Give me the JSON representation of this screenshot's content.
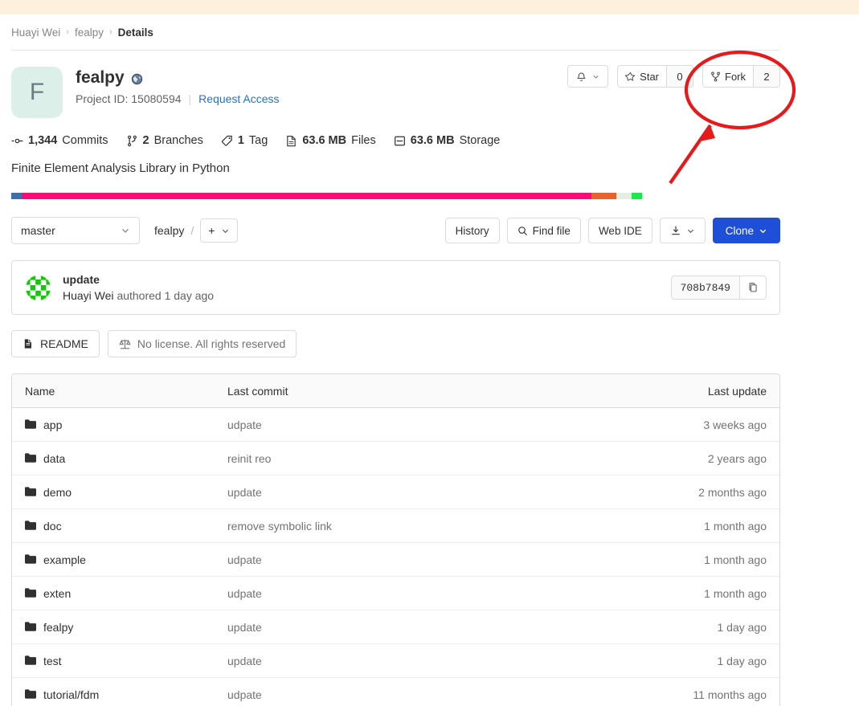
{
  "breadcrumb": {
    "items": [
      {
        "label": "Huayi Wei",
        "current": false
      },
      {
        "label": "fealpy",
        "current": false
      },
      {
        "label": "Details",
        "current": true
      }
    ],
    "separator": "›"
  },
  "project": {
    "avatar_letter": "F",
    "avatar_bg": "#dcefe9",
    "name": "fealpy",
    "visibility_icon": "globe-icon",
    "project_id_label": "Project ID: 15080594",
    "request_access_label": "Request Access",
    "description": "Finite Element Analysis Library in Python"
  },
  "actions": {
    "notification_icon": "bell-icon",
    "notification_caret": "chevron-down-icon",
    "star_icon": "star-icon",
    "star_label": "Star",
    "star_count": "0",
    "fork_icon": "fork-icon",
    "fork_label": "Fork",
    "fork_count": "2"
  },
  "stats": [
    {
      "icon": "commit-icon",
      "value": "1,344",
      "unit": "Commits"
    },
    {
      "icon": "branch-icon",
      "value": "2",
      "unit": "Branches"
    },
    {
      "icon": "tag-icon",
      "value": "1",
      "unit": "Tag"
    },
    {
      "icon": "file-icon",
      "value": "63.6 MB",
      "unit": "Files"
    },
    {
      "icon": "storage-icon",
      "value": "63.6 MB",
      "unit": "Storage"
    }
  ],
  "language_bar": [
    {
      "color": "#3f6fa8",
      "pct": 1.4
    },
    {
      "color": "#fc0a77",
      "pct": 74.0
    },
    {
      "color": "#e9622c",
      "pct": 3.3
    },
    {
      "color": "#e2efe2",
      "pct": 2.0
    },
    {
      "color": "#1ce84b",
      "pct": 1.3
    }
  ],
  "toolbar": {
    "branch": "master",
    "branch_caret": "chevron-down-icon",
    "path_root": "fealpy",
    "path_slash": "/",
    "plus_label": "+",
    "plus_caret": "chevron-down-icon",
    "history_label": "History",
    "find_file_label": "Find file",
    "find_file_icon": "search-icon",
    "web_ide_label": "Web IDE",
    "download_icon": "download-icon",
    "download_caret": "chevron-down-icon",
    "clone_label": "Clone",
    "clone_caret": "chevron-down-icon",
    "clone_color": "#1f4fd8"
  },
  "commit": {
    "avatar_icon": "identicon-avatar",
    "message": "update",
    "author": "Huayi Wei",
    "byline_rest": "authored 1 day ago",
    "sha": "708b7849",
    "copy_icon": "copy-icon"
  },
  "readme_row": {
    "readme_icon": "doc-icon",
    "readme_label": "README",
    "license_icon": "scales-icon",
    "license_label": "No license. All rights reserved"
  },
  "file_table": {
    "columns": [
      "Name",
      "Last commit",
      "Last update"
    ],
    "rows": [
      {
        "icon": "folder-icon",
        "name": "app",
        "commit": "udpate",
        "updated": "3 weeks ago"
      },
      {
        "icon": "folder-icon",
        "name": "data",
        "commit": "reinit reo",
        "updated": "2 years ago"
      },
      {
        "icon": "folder-icon",
        "name": "demo",
        "commit": "update",
        "updated": "2 months ago"
      },
      {
        "icon": "folder-icon",
        "name": "doc",
        "commit": "remove symbolic link",
        "updated": "1 month ago"
      },
      {
        "icon": "folder-icon",
        "name": "example",
        "commit": "udpate",
        "updated": "1 month ago"
      },
      {
        "icon": "folder-icon",
        "name": "exten",
        "commit": "udpate",
        "updated": "1 month ago"
      },
      {
        "icon": "folder-icon",
        "name": "fealpy",
        "commit": "update",
        "updated": "1 day ago"
      },
      {
        "icon": "folder-icon",
        "name": "test",
        "commit": "update",
        "updated": "1 day ago"
      },
      {
        "icon": "folder-icon",
        "name": "tutorial/fdm",
        "commit": "udpate",
        "updated": "11 months ago"
      }
    ]
  },
  "annotation": {
    "color": "#e8191b",
    "ellipse_target": "fork-button",
    "shapes": [
      "highlight-ellipse",
      "pointer-arrow"
    ]
  }
}
